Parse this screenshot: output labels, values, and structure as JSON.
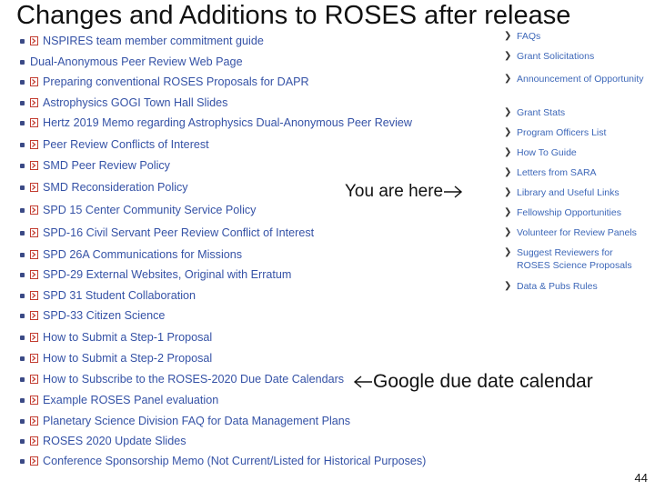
{
  "title": "Changes and Additions to ROSES after release",
  "links": [
    {
      "label": "NSPIRES team member commitment guide",
      "icon": "pdf-icon"
    },
    {
      "label": "Dual-Anonymous Peer Review Web Page",
      "icon": ""
    },
    {
      "label": "Preparing conventional ROSES Proposals for DAPR",
      "icon": "pdf-icon"
    },
    {
      "label": "Astrophysics GOGI Town Hall Slides",
      "icon": "pdf-icon"
    },
    {
      "label": "Hertz 2019 Memo regarding Astrophysics Dual-Anonymous Peer Review",
      "icon": "pdf-icon"
    },
    {
      "label": "Peer Review Conflicts of Interest",
      "icon": "pdf-icon"
    },
    {
      "label": "SMD Peer Review Policy",
      "icon": "pdf-icon"
    },
    {
      "label": "SMD Reconsideration Policy",
      "icon": "pdf-icon"
    },
    {
      "label": "SPD 15 Center Community Service Policy",
      "icon": "pdf-icon"
    },
    {
      "label": "SPD-16 Civil Servant Peer Review Conflict of Interest",
      "icon": "pdf-icon"
    },
    {
      "label": "SPD 26A Communications for Missions",
      "icon": "pdf-icon"
    },
    {
      "label": "SPD-29 External Websites, Original with Erratum",
      "icon": "pdf-icon"
    },
    {
      "label": "SPD 31 Student Collaboration",
      "icon": "pdf-icon"
    },
    {
      "label": "SPD-33 Citizen Science",
      "icon": "pdf-icon"
    },
    {
      "label": "How to Submit a Step-1 Proposal",
      "icon": "pdf-icon"
    },
    {
      "label": "How to Submit a Step-2 Proposal",
      "icon": "pdf-icon"
    },
    {
      "label": "How to Subscribe to the ROSES-2020 Due Date Calendars",
      "icon": "pdf-icon"
    },
    {
      "label": "Example ROSES Panel evaluation",
      "icon": "pdf-icon"
    },
    {
      "label": "Planetary Science Division FAQ for Data Management Plans",
      "icon": "pdf-icon"
    },
    {
      "label": "ROSES 2020 Update Slides",
      "icon": "pdf-icon"
    },
    {
      "label": "Conference Sponsorship Memo (Not Current/Listed for Historical Purposes)",
      "icon": "pdf-icon"
    }
  ],
  "sidenav": [
    {
      "label": "FAQs"
    },
    {
      "label": "Grant Solicitations"
    },
    {
      "label": "Announcement of Opportunity"
    },
    {
      "label": "Grant Stats"
    },
    {
      "label": "Program Officers List"
    },
    {
      "label": "How To Guide"
    },
    {
      "label": "Letters from SARA"
    },
    {
      "label": "Library and Useful Links"
    },
    {
      "label": "Fellowship Opportunities"
    },
    {
      "label": "Volunteer for Review Panels"
    },
    {
      "label": "Suggest Reviewers for ROSES Science Proposals"
    },
    {
      "label": "Data & Pubs Rules"
    }
  ],
  "you_are_here": "You are here",
  "calendar_note": "Google due date calendar",
  "page_number": "44",
  "colors": {
    "link": "#3552a6",
    "nav_link": "#3d67b8",
    "bullet": "#3b4a86",
    "pdf_icon": "#c23b2f"
  }
}
